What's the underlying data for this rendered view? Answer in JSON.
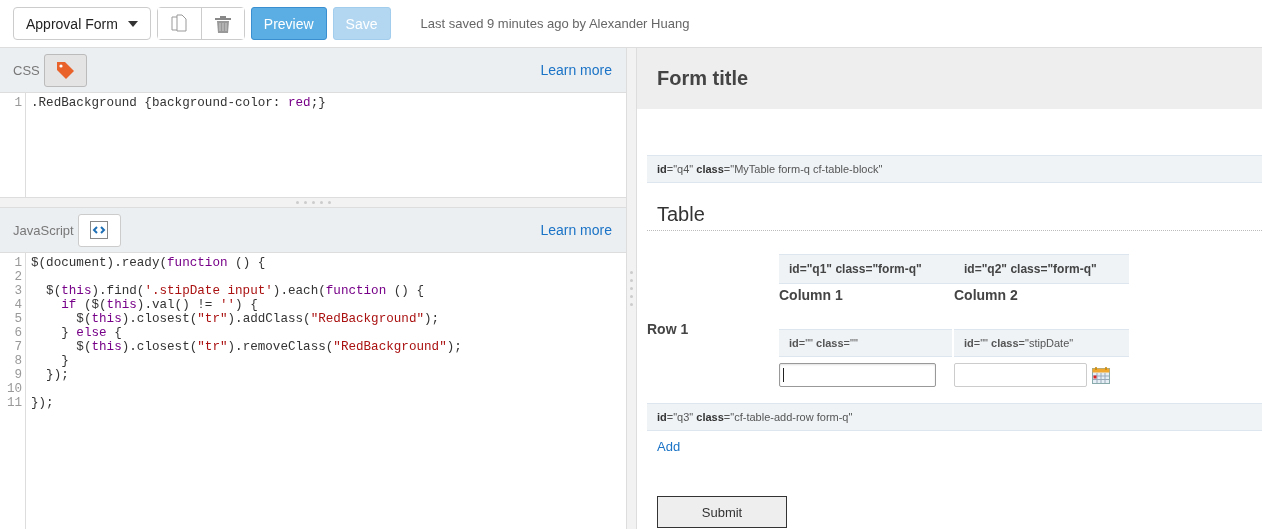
{
  "toolbar": {
    "form_select": "Approval Form",
    "preview": {
      "label": "Preview",
      "disabled": false
    },
    "save": {
      "label": "Save",
      "disabled": true
    },
    "status": "Last saved 9 minutes ago by Alexander Huang"
  },
  "editors": [
    {
      "label": "CSS",
      "kind": "css",
      "pressed": true,
      "link": "Learn more",
      "lines": [
        {
          "number": "1",
          "tokens": [
            {
              "text": ".RedBackground {background-color: ",
              "kind": "plain"
            },
            {
              "text": "red",
              "kind": "keyword"
            },
            {
              "text": ";}",
              "kind": "plain"
            }
          ]
        }
      ]
    },
    {
      "label": "JavaScript",
      "kind": "js",
      "pressed": false,
      "link": "Learn more",
      "lines": [
        {
          "number": "1",
          "tokens": [
            {
              "text": "$(document).ready(",
              "kind": "plain"
            },
            {
              "text": "function",
              "kind": "keyword"
            },
            {
              "text": " () {",
              "kind": "plain"
            }
          ]
        },
        {
          "number": "2"
        },
        {
          "number": "3",
          "tokens": [
            {
              "text": "  $(",
              "kind": "plain"
            },
            {
              "text": "this",
              "kind": "keyword"
            },
            {
              "text": ").find(",
              "kind": "plain"
            },
            {
              "text": "'.stipDate input'",
              "kind": "string"
            },
            {
              "text": ").each(",
              "kind": "plain"
            },
            {
              "text": "function",
              "kind": "keyword"
            },
            {
              "text": " () {",
              "kind": "plain"
            }
          ]
        },
        {
          "number": "4",
          "tokens": [
            {
              "text": "    if",
              "kind": "keyword"
            },
            {
              "text": " ($(",
              "kind": "plain"
            },
            {
              "text": "this",
              "kind": "keyword"
            },
            {
              "text": ").val() != ",
              "kind": "plain"
            },
            {
              "text": "''",
              "kind": "string"
            },
            {
              "text": ") {",
              "kind": "plain"
            }
          ]
        },
        {
          "number": "5",
          "tokens": [
            {
              "text": "      $(",
              "kind": "plain"
            },
            {
              "text": "this",
              "kind": "keyword"
            },
            {
              "text": ").closest(",
              "kind": "plain"
            },
            {
              "text": "\"tr\"",
              "kind": "string"
            },
            {
              "text": ").addClass(",
              "kind": "plain"
            },
            {
              "text": "\"RedBackground\"",
              "kind": "string"
            },
            {
              "text": ");",
              "kind": "plain"
            }
          ]
        },
        {
          "number": "6",
          "tokens": [
            {
              "text": "    } ",
              "kind": "plain"
            },
            {
              "text": "else",
              "kind": "keyword"
            },
            {
              "text": " {",
              "kind": "plain"
            }
          ]
        },
        {
          "number": "7",
          "tokens": [
            {
              "text": "      $(",
              "kind": "plain"
            },
            {
              "text": "this",
              "kind": "keyword"
            },
            {
              "text": ").closest(",
              "kind": "plain"
            },
            {
              "text": "\"tr\"",
              "kind": "string"
            },
            {
              "text": ").removeClass(",
              "kind": "plain"
            },
            {
              "text": "\"RedBackground\"",
              "kind": "string"
            },
            {
              "text": ");",
              "kind": "plain"
            }
          ]
        },
        {
          "number": "8",
          "tokens": [
            {
              "text": "    }",
              "kind": "plain"
            }
          ]
        },
        {
          "number": "9",
          "tokens": [
            {
              "text": "  });",
              "kind": "plain"
            }
          ]
        },
        {
          "number": "10"
        },
        {
          "number": "11",
          "tokens": [
            {
              "text": "});",
              "kind": "plain"
            }
          ]
        }
      ]
    }
  ],
  "form": {
    "title": "Form title",
    "table_block": {
      "info": "**id**=\"q4\" **class**=\"MyTable form-q cf-table-block\"",
      "heading": "Table",
      "column_infos": [
        "id=\"q1\" class=\"form-q\"",
        "id=\"q2\" class=\"form-q\""
      ],
      "columns": [
        "Column 1",
        "Column 2"
      ],
      "rows": [
        {
          "label": "Row 1",
          "cells": [
            {
              "info": "**id**=\"\" **class**=\"\"",
              "kind": "text",
              "focused": true
            },
            {
              "info": "**id**=\"\" **class**=\"stipDate\"",
              "kind": "date",
              "focused": false
            }
          ]
        }
      ]
    },
    "add_block": {
      "info": "**id**=\"q3\" **class**=\"cf-table-add-row form-q\"",
      "link": "Add"
    },
    "submit": "Submit"
  }
}
